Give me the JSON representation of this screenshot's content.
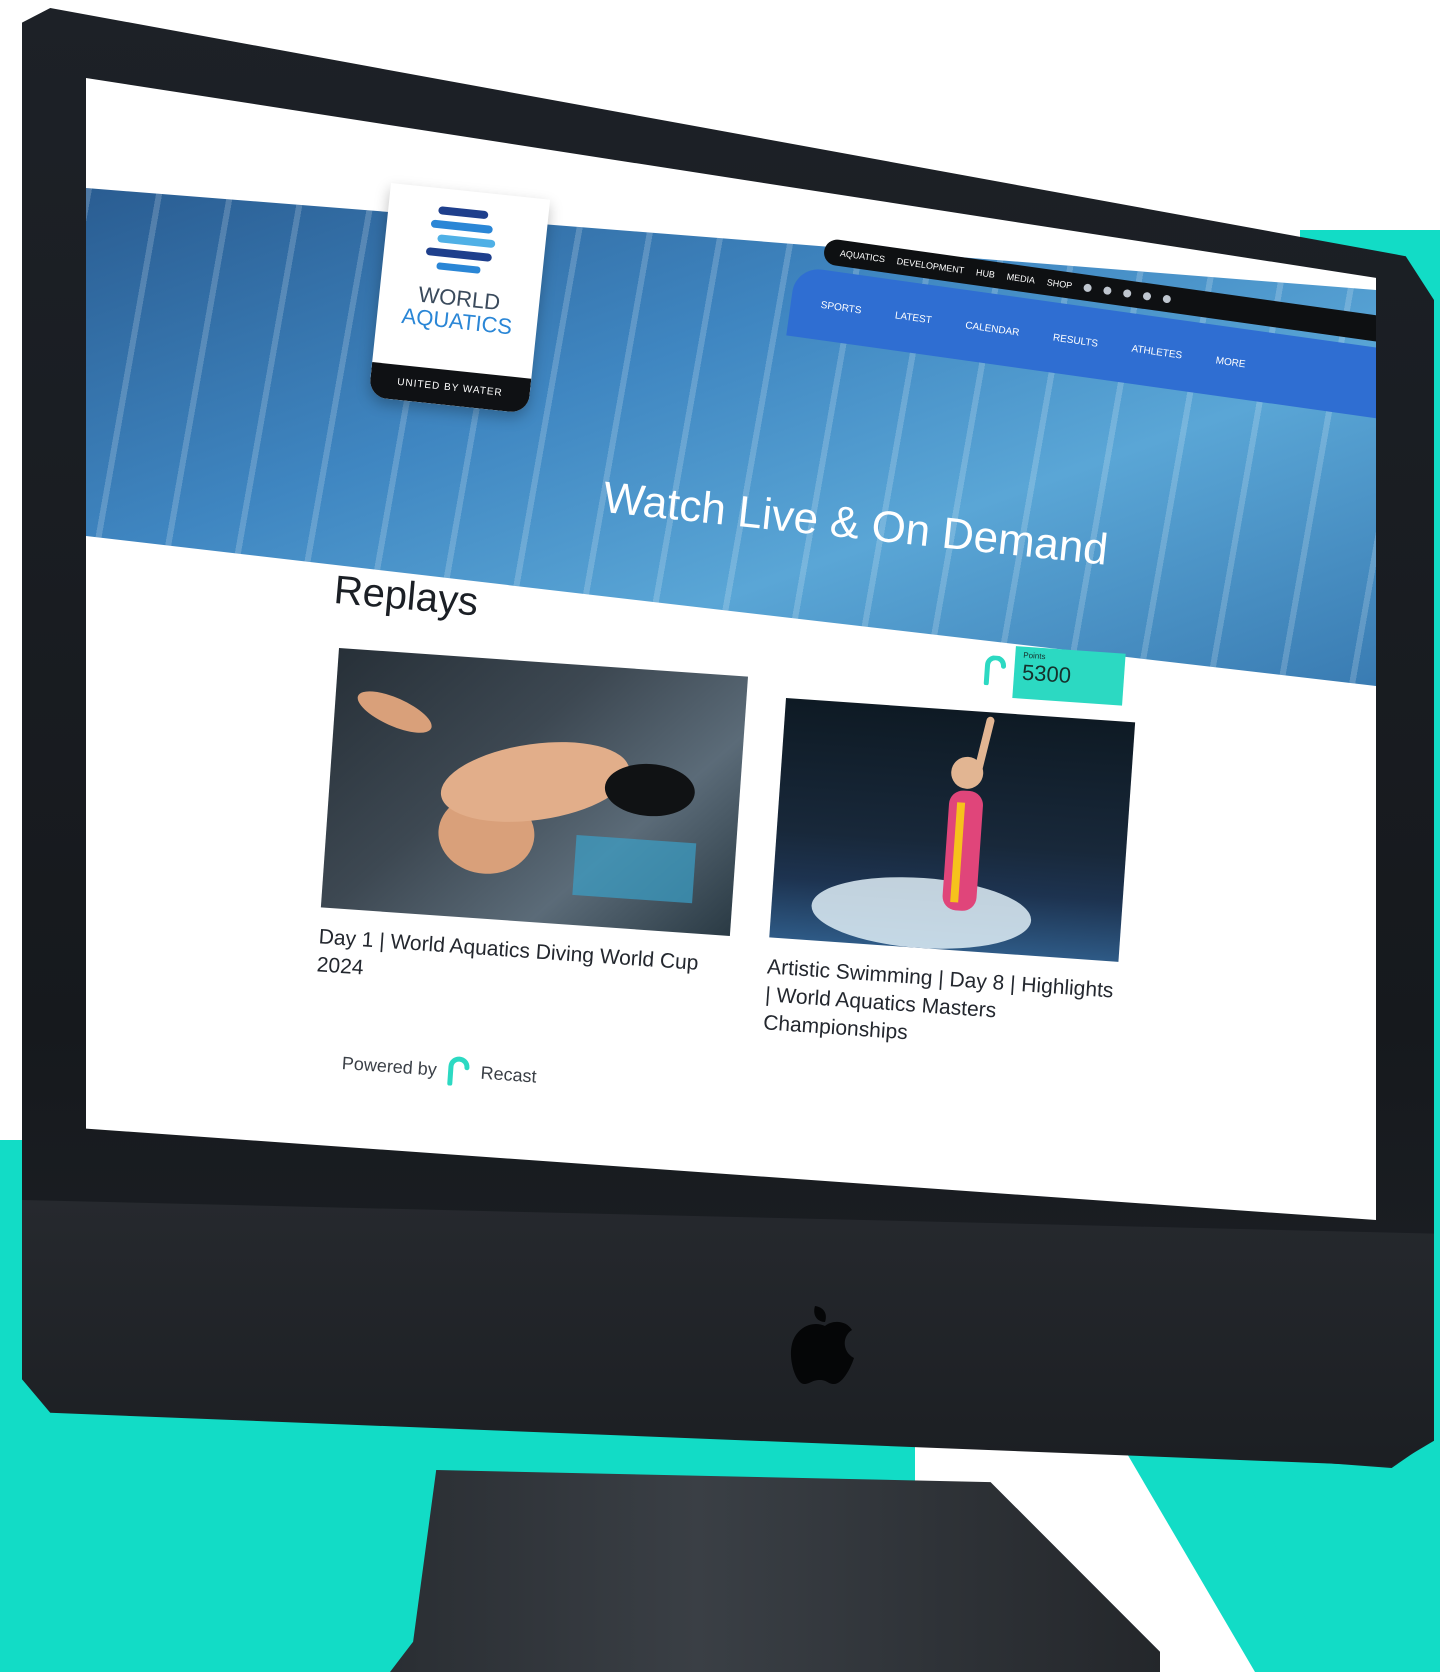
{
  "hero": {
    "headline": "Watch Live & On Demand"
  },
  "logo": {
    "line1": "WORLD",
    "line2": "AQUATICS",
    "tagline": "UNITED BY WATER"
  },
  "topbar": {
    "items": [
      "AQUATICS",
      "DEVELOPMENT",
      "HUB",
      "MEDIA",
      "SHOP"
    ]
  },
  "nav": {
    "items": [
      "SPORTS",
      "LATEST",
      "CALENDAR",
      "RESULTS",
      "ATHLETES",
      "MORE"
    ]
  },
  "section": {
    "title": "Replays"
  },
  "score_badge": {
    "label": "Points",
    "value": "5300"
  },
  "cards": [
    {
      "title": "Day 1 | World Aquatics Diving World Cup 2024"
    },
    {
      "title": "Artistic Swimming | Day 8 | Highlights | World Aquatics Masters Championships"
    }
  ],
  "footer": {
    "powered_by": "Powered by",
    "brand": "Recast"
  },
  "colors": {
    "teal": "#12dcc6",
    "nav_blue": "#2f6ed2",
    "monitor": "#1b1e22"
  },
  "icons": [
    "recast-logo-icon",
    "apple-logo-icon",
    "world-aquatics-logo-icon"
  ]
}
